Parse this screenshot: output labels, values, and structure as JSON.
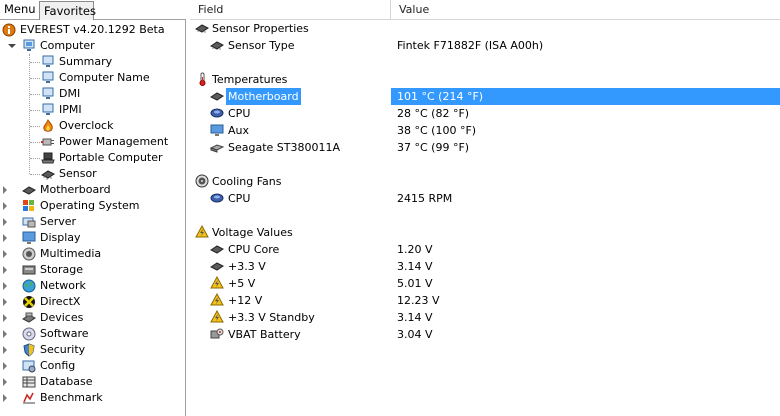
{
  "tabs": {
    "menu": "Menu",
    "favorites": "Favorites"
  },
  "tree": {
    "root": "EVEREST v4.20.1292 Beta",
    "computer": "Computer",
    "computer_children": [
      "Summary",
      "Computer Name",
      "DMI",
      "IPMI",
      "Overclock",
      "Power Management",
      "Portable Computer",
      "Sensor"
    ],
    "categories": [
      "Motherboard",
      "Operating System",
      "Server",
      "Display",
      "Multimedia",
      "Storage",
      "Network",
      "DirectX",
      "Devices",
      "Software",
      "Security",
      "Config",
      "Database",
      "Benchmark"
    ]
  },
  "table": {
    "col_field": "Field",
    "col_value": "Value",
    "groups": [
      {
        "title": "Sensor Properties",
        "rows": [
          {
            "field": "Sensor Type",
            "value": "Fintek F71882F  (ISA A00h)"
          }
        ]
      },
      {
        "title": "Temperatures",
        "rows": [
          {
            "field": "Motherboard",
            "value": "101 °C  (214 °F)"
          },
          {
            "field": "CPU",
            "value": "28 °C  (82 °F)"
          },
          {
            "field": "Aux",
            "value": "38 °C  (100 °F)"
          },
          {
            "field": "Seagate ST380011A",
            "value": "37 °C  (99 °F)"
          }
        ]
      },
      {
        "title": "Cooling Fans",
        "rows": [
          {
            "field": "CPU",
            "value": "2415 RPM"
          }
        ]
      },
      {
        "title": "Voltage Values",
        "rows": [
          {
            "field": "CPU Core",
            "value": "1.20 V"
          },
          {
            "field": "+3.3 V",
            "value": "3.14 V"
          },
          {
            "field": "+5 V",
            "value": "5.01 V"
          },
          {
            "field": "+12 V",
            "value": "12.23 V"
          },
          {
            "field": "+3.3 V Standby",
            "value": "3.14 V"
          },
          {
            "field": "VBAT Battery",
            "value": "3.04 V"
          }
        ]
      }
    ]
  },
  "colors": {
    "selection": "#3399ff",
    "border": "#a0a0a0"
  }
}
